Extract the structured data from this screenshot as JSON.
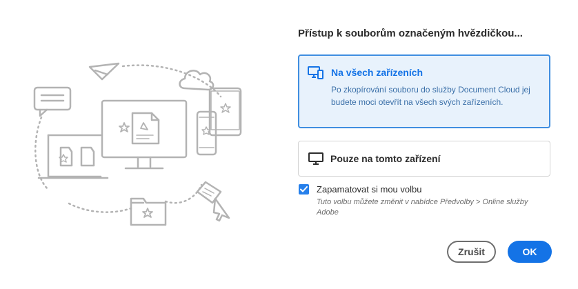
{
  "dialog": {
    "title": "Přístup k souborům označeným hvězdičkou..."
  },
  "options": [
    {
      "title": "Na všech zařízeních",
      "description": "Po zkopírování souboru do služby Document Cloud jej budete moci otevřít na všech svých zařízeních.",
      "icon": "devices-icon",
      "selected": true
    },
    {
      "title": "Pouze na tomto zařízení",
      "icon": "monitor-icon",
      "selected": false
    }
  ],
  "remember": {
    "label": "Zapamatovat si mou volbu",
    "note": "Tuto volbu můžete změnit v nabídce Předvolby > Online služby Adobe",
    "checked": true
  },
  "buttons": {
    "cancel": "Zrušit",
    "ok": "OK"
  },
  "colors": {
    "accent": "#1473e6",
    "selected_bg": "#e8f2fc",
    "selected_border": "#3f8ee0"
  }
}
